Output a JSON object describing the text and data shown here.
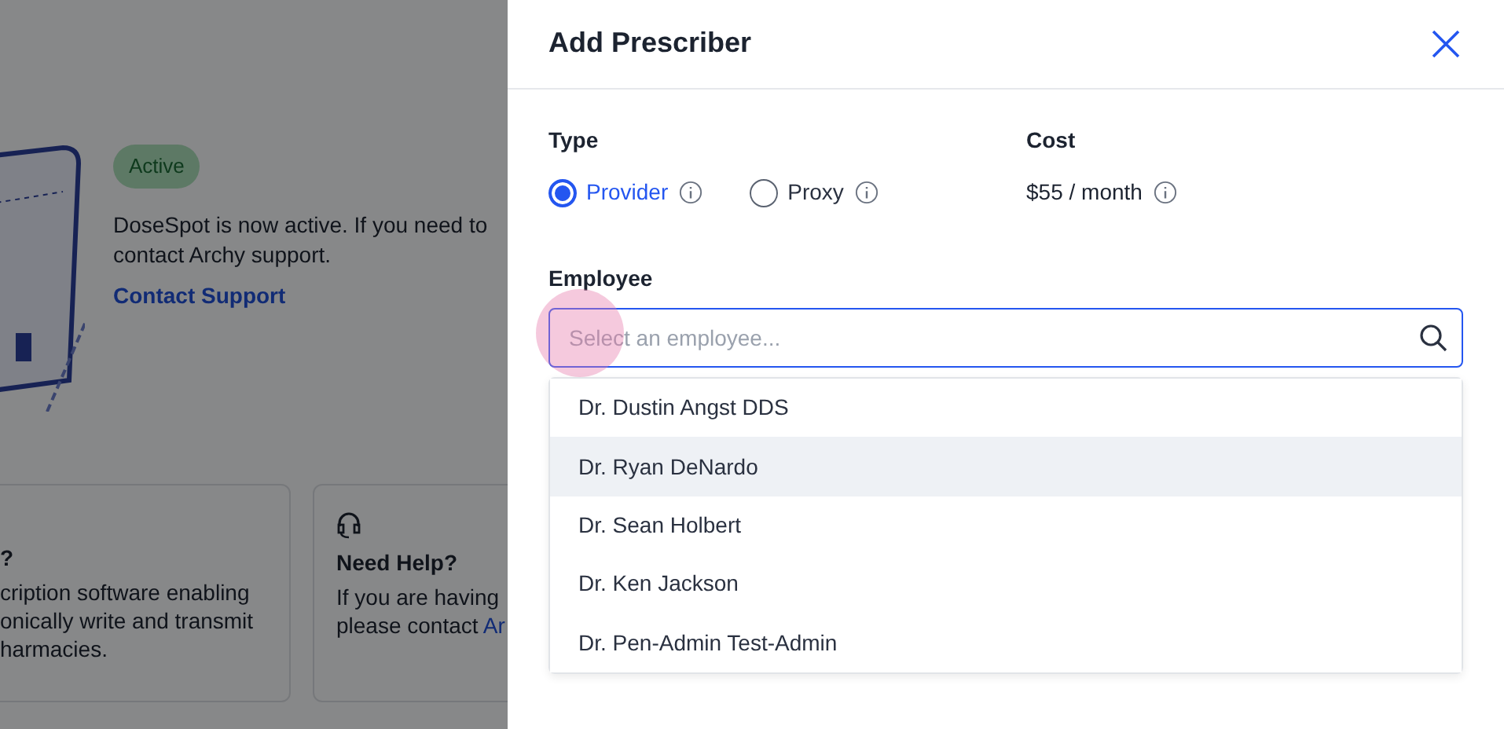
{
  "background": {
    "status_badge": "Active",
    "message_lines": [
      "DoseSpot is now active. If you need to",
      "contact Archy support."
    ],
    "contact_link": "Contact Support",
    "cards": [
      {
        "kind": "info",
        "title": "?",
        "lines": [
          "cription software enabling",
          "onically write and transmit",
          "harmacies."
        ]
      },
      {
        "kind": "help",
        "title": "Need Help?",
        "lines": [
          "If you are having",
          "please contact "
        ],
        "link": "Ar"
      }
    ]
  },
  "drawer": {
    "title": "Add Prescriber",
    "type": {
      "label": "Type",
      "options": [
        {
          "label": "Provider",
          "selected": true
        },
        {
          "label": "Proxy",
          "selected": false
        }
      ]
    },
    "cost": {
      "label": "Cost",
      "value": "$55 / month"
    },
    "employee": {
      "label": "Employee",
      "placeholder": "Select an employee...",
      "options": [
        {
          "label": "Dr. Dustin Angst DDS",
          "highlighted": false
        },
        {
          "label": "Dr. Ryan DeNardo",
          "highlighted": true
        },
        {
          "label": "Dr. Sean Holbert",
          "highlighted": false
        },
        {
          "label": "Dr. Ken Jackson",
          "highlighted": false
        },
        {
          "label": "Dr. Pen-Admin Test-Admin",
          "highlighted": false
        }
      ]
    }
  }
}
